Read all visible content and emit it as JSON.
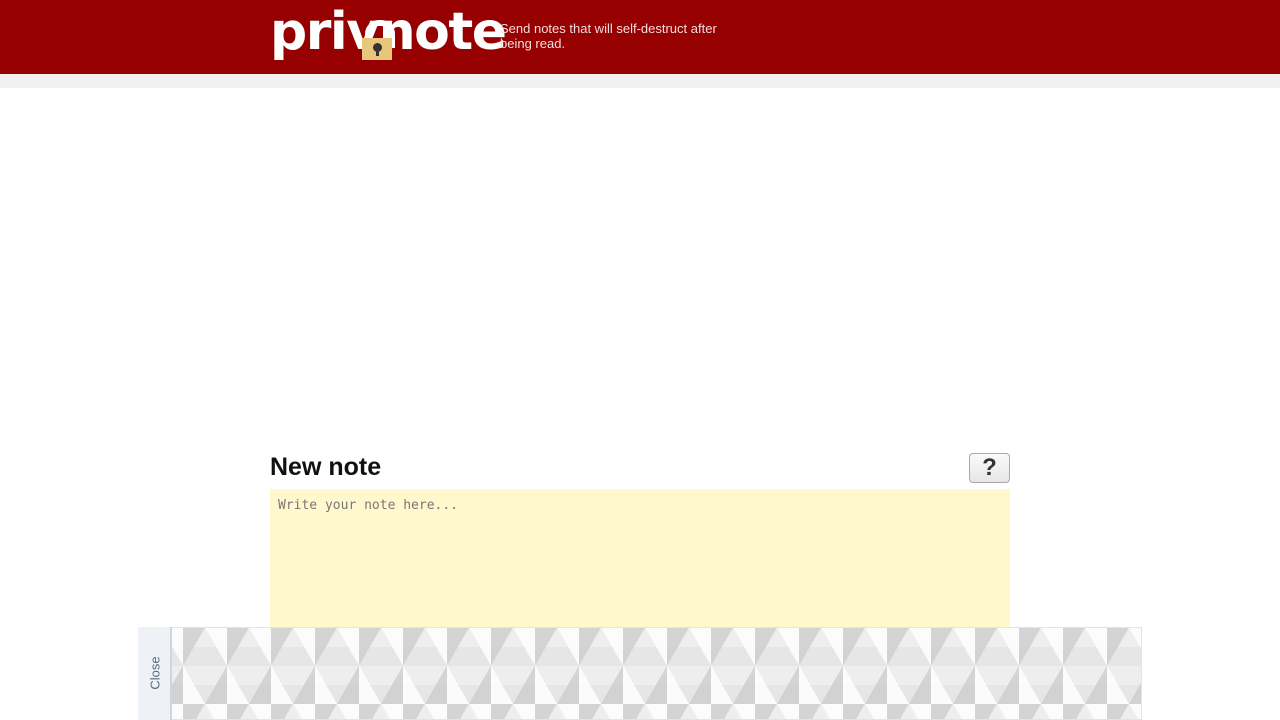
{
  "header": {
    "logo_text": "privnote",
    "tagline": "Send notes that will self-destruct after being read."
  },
  "note": {
    "title": "New note",
    "help_label": "?",
    "placeholder": "Write your note here...",
    "value": ""
  },
  "ad_panel": {
    "close_label": "Close"
  },
  "colors": {
    "header_bg": "#970000",
    "note_bg": "#fff8cd",
    "lock": "#e8c77d"
  }
}
